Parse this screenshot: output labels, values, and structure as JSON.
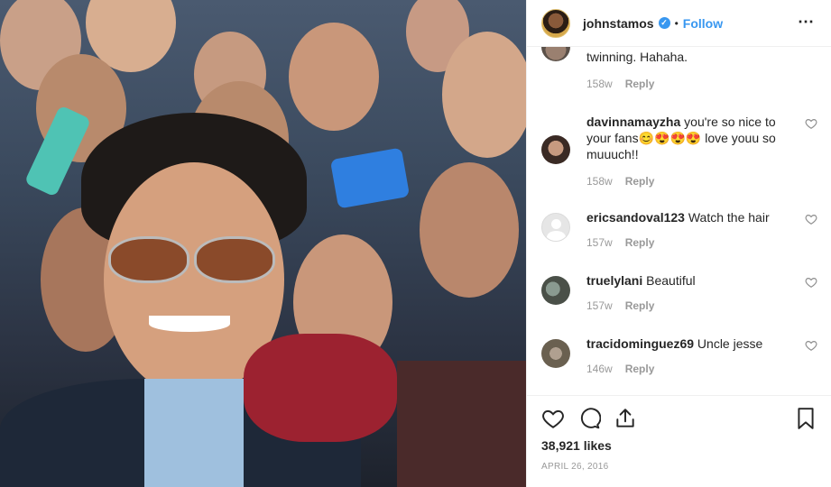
{
  "header": {
    "username": "johnstamos",
    "verified_mark": "✓",
    "separator": "•",
    "follow_label": "Follow",
    "more_icon": "⋯"
  },
  "comments": [
    {
      "username": "",
      "text": "twinning. Hahaha.",
      "age": "158w",
      "reply_label": "Reply",
      "has_heart": false
    },
    {
      "username": "davinnamayzha",
      "text": "you're so nice to your fans😊😍😍😍 love youu so muuuch!!",
      "age": "158w",
      "reply_label": "Reply",
      "has_heart": true
    },
    {
      "username": "ericsandoval123",
      "text": "Watch the hair",
      "age": "157w",
      "reply_label": "Reply",
      "has_heart": true
    },
    {
      "username": "truelylani",
      "text": "Beautiful",
      "age": "157w",
      "reply_label": "Reply",
      "has_heart": true
    },
    {
      "username": "tracidominguez69",
      "text": "Uncle jesse",
      "age": "146w",
      "reply_label": "Reply",
      "has_heart": true
    }
  ],
  "actions": {
    "like_icon": "heart-icon",
    "comment_icon": "comment-icon",
    "share_icon": "share-icon",
    "save_icon": "bookmark-icon"
  },
  "likes": "38,921 likes",
  "date": "APRIL 26, 2016",
  "colors": {
    "accent": "#3897f0",
    "muted": "#999999",
    "text": "#262626",
    "border": "#efefef"
  }
}
